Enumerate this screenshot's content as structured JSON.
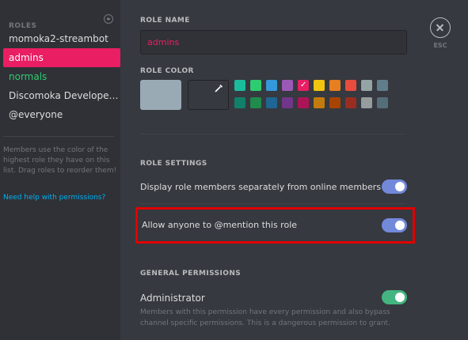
{
  "sidebar": {
    "header": "ROLES",
    "add_icon": "plus-circle-icon",
    "roles": [
      {
        "label": "momoka2-streambot",
        "color": "#dcddde",
        "selected": false
      },
      {
        "label": "admins",
        "color": "#ffffff",
        "selected": true
      },
      {
        "label": "normals",
        "color": "#2ecc71",
        "selected": false
      },
      {
        "label": "Discomoka Developer Ed..",
        "color": "#dcddde",
        "selected": false
      },
      {
        "label": "@everyone",
        "color": "#dcddde",
        "selected": false
      }
    ],
    "help_text": "Members use the color of the highest role they have on this list. Drag roles to reorder them!",
    "help_link": "Need help with permissions?"
  },
  "main": {
    "role_name_label": "ROLE NAME",
    "role_name_value": "admins",
    "role_color_label": "ROLE COLOR",
    "selected_color": "#99aab5",
    "picker_icon": "eyedropper-icon",
    "swatches_row1": [
      "#1abc9c",
      "#2ecc71",
      "#3498db",
      "#9b59b6",
      "#e91e63",
      "#f1c40f",
      "#e67e22",
      "#e74c3c",
      "#95a5a6",
      "#607d8b"
    ],
    "swatches_row2": [
      "#11806a",
      "#1f8b4c",
      "#206694",
      "#71368a",
      "#ad1457",
      "#c27c0e",
      "#a84300",
      "#992d22",
      "#979c9f",
      "#546e7a"
    ],
    "checked_swatch_index": 4,
    "role_settings_label": "ROLE SETTINGS",
    "settings": [
      {
        "label": "Display role members separately from online members",
        "enabled": true
      },
      {
        "label": "Allow anyone to @mention this role",
        "enabled": true
      }
    ],
    "general_permissions_label": "GENERAL PERMISSIONS",
    "administrator_label": "Administrator",
    "administrator_enabled": true,
    "administrator_desc": "Members with this permission have every permission and also bypass channel specific permissions. This is a dangerous permission to grant."
  },
  "close": {
    "icon": "close-icon",
    "label": "ESC"
  },
  "colors": {
    "accent_blurple": "#7289da",
    "toggle_green": "#43b581",
    "highlight_red": "#e00000"
  }
}
